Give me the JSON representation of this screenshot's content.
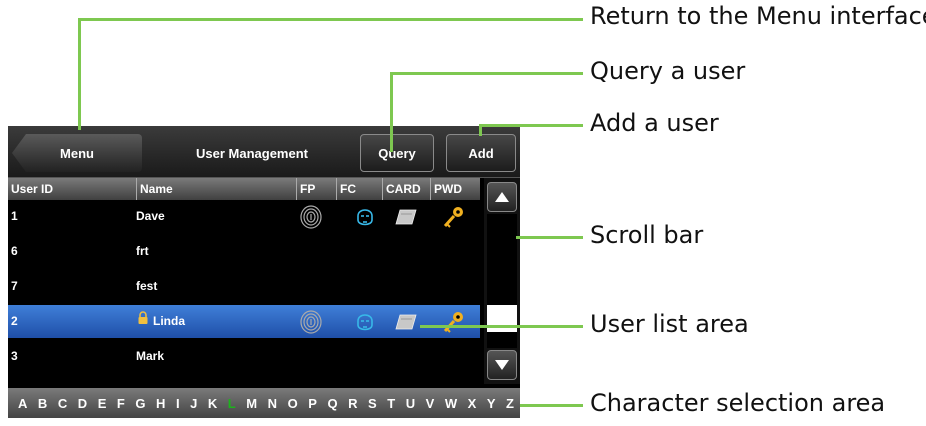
{
  "screen": {
    "menu_label": "Menu",
    "title": "User Management",
    "query_label": "Query",
    "add_label": "Add",
    "columns": [
      "User ID",
      "Name",
      "FP",
      "FC",
      "CARD",
      "PWD"
    ],
    "users": [
      {
        "id": "1",
        "name": "Dave",
        "fp": true,
        "fc": true,
        "card": true,
        "pwd": true,
        "locked": false,
        "selected": false
      },
      {
        "id": "6",
        "name": "frt",
        "fp": false,
        "fc": false,
        "card": false,
        "pwd": false,
        "locked": false,
        "selected": false
      },
      {
        "id": "7",
        "name": "fest",
        "fp": false,
        "fc": false,
        "card": false,
        "pwd": false,
        "locked": false,
        "selected": false
      },
      {
        "id": "2",
        "name": "Linda",
        "fp": true,
        "fc": true,
        "card": true,
        "pwd": true,
        "locked": true,
        "selected": true
      },
      {
        "id": "3",
        "name": "Mark",
        "fp": false,
        "fc": false,
        "card": false,
        "pwd": false,
        "locked": false,
        "selected": false
      }
    ],
    "scroll_position": 0.85,
    "scroll_fraction": 0.2,
    "letters": [
      "A",
      "B",
      "C",
      "D",
      "E",
      "F",
      "G",
      "H",
      "I",
      "J",
      "K",
      "L",
      "M",
      "N",
      "O",
      "P",
      "Q",
      "R",
      "S",
      "T",
      "U",
      "V",
      "W",
      "X",
      "Y",
      "Z"
    ],
    "active_letter": "L"
  },
  "callouts": {
    "menu": "Return to the Menu interface",
    "query": "Query a user",
    "add": "Add a user",
    "scroll": "Scroll bar",
    "list": "User list area",
    "chars": "Character selection area"
  },
  "colors": {
    "selected_row": "#2a62c4",
    "active_letter": "#1db31d",
    "callout_line": "#7ec850",
    "key": "#f0b020"
  }
}
